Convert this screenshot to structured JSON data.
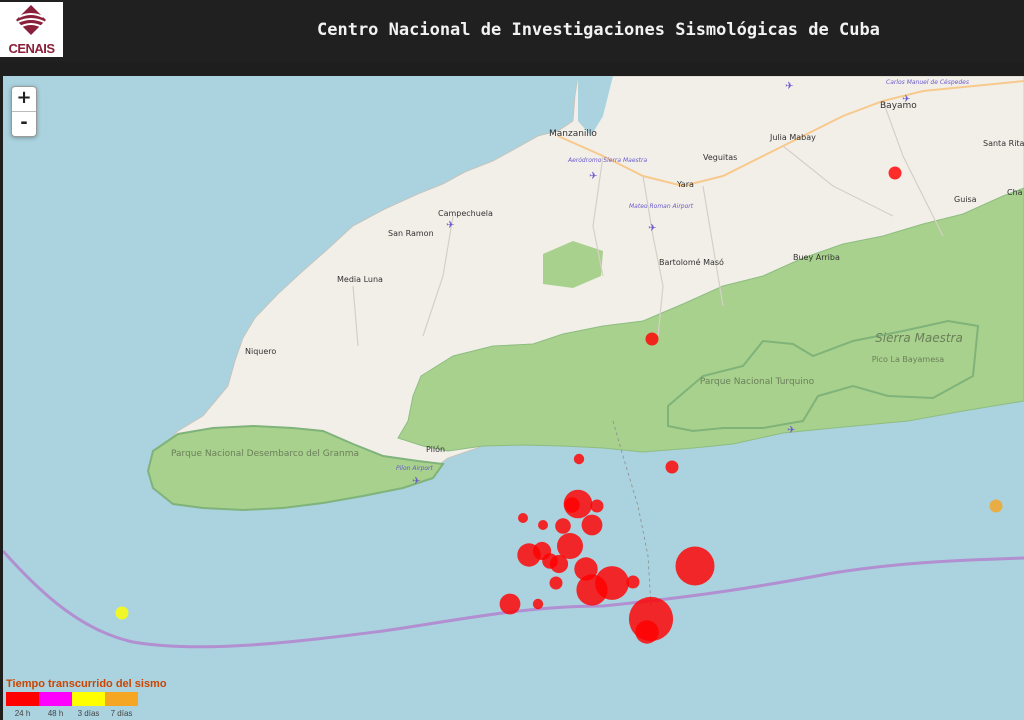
{
  "header": {
    "logo_text": "CENAIS",
    "title": "Centro Nacional de Investigaciones Sismológicas de Cuba"
  },
  "zoom": {
    "in_label": "+",
    "out_label": "-"
  },
  "map": {
    "colors": {
      "water": "#aad3df",
      "land": "#f2efe9",
      "park": "#a8d18d",
      "park_border": "#7fb37a",
      "boundary": "#b18fd0",
      "quake_recent": "#ff0000",
      "quake_3d": "#ffff00",
      "quake_7d": "#f5a623"
    },
    "places": [
      {
        "id": "bayamo",
        "name": "Bayamo"
      },
      {
        "id": "manzanillo",
        "name": "Manzanillo"
      },
      {
        "id": "veguitas",
        "name": "Veguitas"
      },
      {
        "id": "yara",
        "name": "Yara"
      },
      {
        "id": "julia-mabay",
        "name": "Julia Mabay"
      },
      {
        "id": "santa-rita",
        "name": "Santa Rita"
      },
      {
        "id": "guisa",
        "name": "Guisa"
      },
      {
        "id": "campechuela",
        "name": "Campechuela"
      },
      {
        "id": "san-ramon",
        "name": "San Ramon"
      },
      {
        "id": "media-luna",
        "name": "Media Luna"
      },
      {
        "id": "niquero",
        "name": "Niquero"
      },
      {
        "id": "bartolome-maso",
        "name": "Bartolomé Masó"
      },
      {
        "id": "buey-arriba",
        "name": "Buey Arriba"
      },
      {
        "id": "pilon",
        "name": "Pilón"
      },
      {
        "id": "chaparra",
        "name": "Cha"
      }
    ],
    "airports": [
      {
        "id": "sierra-maestra",
        "name": "Aeródromo Sierra Maestra"
      },
      {
        "id": "mateo-roman",
        "name": "Mateo Roman Airport"
      },
      {
        "id": "pilon-airport",
        "name": "Pilon Airport"
      },
      {
        "id": "carlos-manuel",
        "name": "Carlos Manuel de Céspedes"
      }
    ],
    "parks": [
      {
        "id": "granma",
        "name": "Parque Nacional Desembarco del Granma"
      },
      {
        "id": "turquino",
        "name": "Parque Nacional Turquino"
      }
    ],
    "ranges": [
      {
        "id": "sierra-maestra-range",
        "name": "Sierra Maestra"
      }
    ],
    "peaks": [
      {
        "id": "bayamesa",
        "name": "Pico La Bayamesa"
      }
    ],
    "earthquakes": [
      {
        "id": "q01",
        "age": "24h",
        "magnitude": 3.0
      },
      {
        "id": "q02",
        "age": "24h",
        "magnitude": 3.0
      },
      {
        "id": "q03",
        "age": "24h",
        "magnitude": 2.8
      },
      {
        "id": "q04",
        "age": "24h",
        "magnitude": 3.0
      },
      {
        "id": "q05",
        "age": "24h",
        "magnitude": 2.6
      },
      {
        "id": "q06",
        "age": "24h",
        "magnitude": 2.6
      },
      {
        "id": "q07",
        "age": "24h",
        "magnitude": 3.2
      },
      {
        "id": "q08",
        "age": "24h",
        "magnitude": 3.2
      },
      {
        "id": "q09",
        "age": "24h",
        "magnitude": 4.2
      },
      {
        "id": "q10",
        "age": "24h",
        "magnitude": 3.0
      },
      {
        "id": "q11",
        "age": "24h",
        "magnitude": 3.6
      },
      {
        "id": "q12",
        "age": "24h",
        "magnitude": 3.4
      },
      {
        "id": "q13",
        "age": "24h",
        "magnitude": 4.0
      },
      {
        "id": "q14",
        "age": "24h",
        "magnitude": 3.8
      },
      {
        "id": "q15",
        "age": "24h",
        "magnitude": 3.2
      },
      {
        "id": "q16",
        "age": "24h",
        "magnitude": 3.4
      },
      {
        "id": "q17",
        "age": "24h",
        "magnitude": 3.0
      },
      {
        "id": "q18",
        "age": "24h",
        "magnitude": 3.8
      },
      {
        "id": "q19",
        "age": "24h",
        "magnitude": 4.6
      },
      {
        "id": "q20",
        "age": "24h",
        "magnitude": 4.4
      },
      {
        "id": "q21",
        "age": "24h",
        "magnitude": 3.0
      },
      {
        "id": "q22",
        "age": "24h",
        "magnitude": 5.0
      },
      {
        "id": "q23",
        "age": "24h",
        "magnitude": 3.6
      },
      {
        "id": "q24",
        "age": "24h",
        "magnitude": 2.8
      },
      {
        "id": "q25",
        "age": "24h",
        "magnitude": 5.4
      },
      {
        "id": "q26",
        "age": "24h",
        "magnitude": 3.8
      },
      {
        "id": "q27",
        "age": "3d",
        "magnitude": 3.0
      },
      {
        "id": "q28",
        "age": "7d",
        "magnitude": 3.0
      }
    ]
  },
  "legend": {
    "title": "Tiempo transcurrido del sismo",
    "items": [
      {
        "label": "24 h",
        "color": "#ff0000"
      },
      {
        "label": "48 h",
        "color": "#ff00ff"
      },
      {
        "label": "3 días",
        "color": "#ffff00"
      },
      {
        "label": "7 días",
        "color": "#f5a623"
      }
    ]
  }
}
